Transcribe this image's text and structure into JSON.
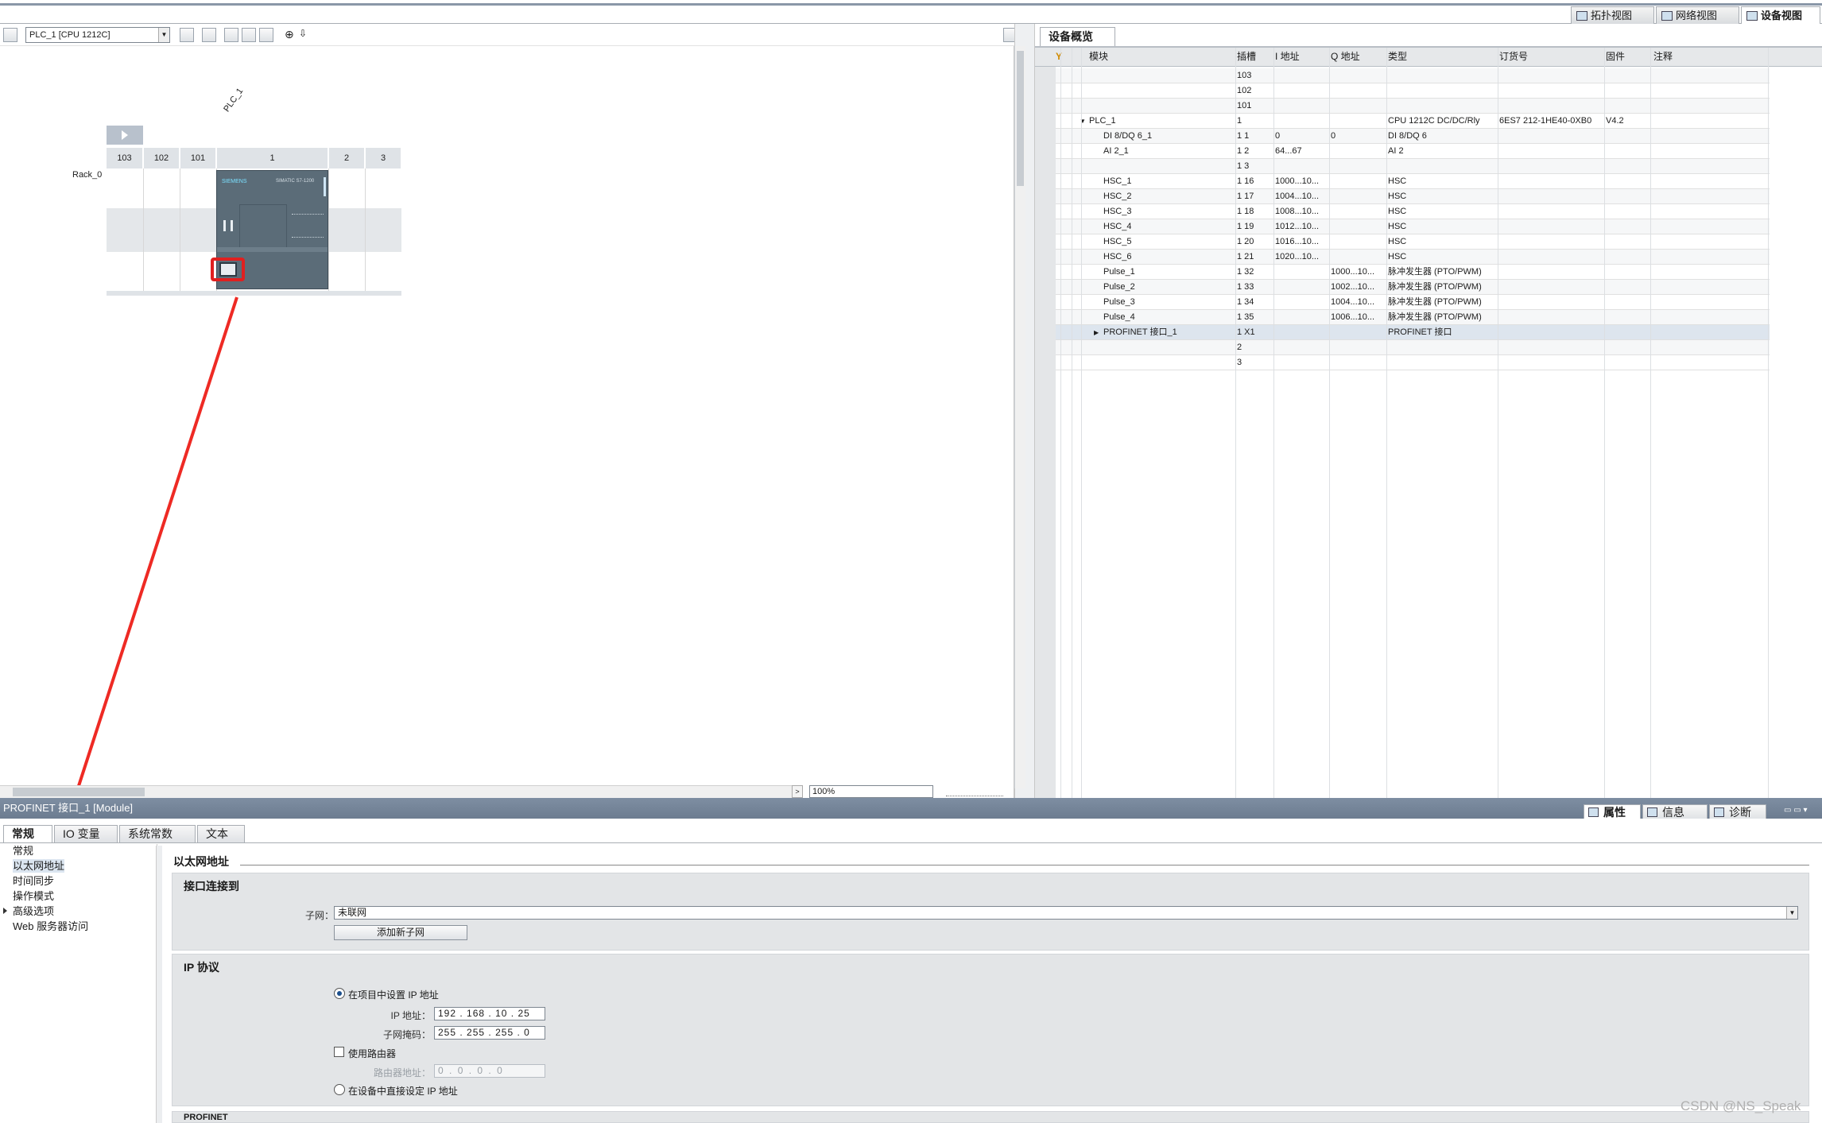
{
  "views": {
    "topology": "拓扑视图",
    "network": "网络视图",
    "device": "设备视图"
  },
  "canvas": {
    "device_select": "PLC_1 [CPU 1212C]",
    "plc_label": "PLC_1",
    "rack_label": "Rack_0",
    "slots": [
      "103",
      "102",
      "101",
      "1",
      "2",
      "3"
    ],
    "zoom": "100%",
    "cpu_brand": "SIEMENS",
    "cpu_model": "SIMATIC S7-1200"
  },
  "overview": {
    "tab": "设备概览",
    "columns": {
      "module": "模块",
      "slot": "插槽",
      "i_addr": "I 地址",
      "q_addr": "Q 地址",
      "type": "类型",
      "order": "订货号",
      "firmware": "固件",
      "comment": "注释"
    },
    "rows": [
      {
        "module": "",
        "slot": "103",
        "i": "",
        "q": "",
        "type": "",
        "order": "",
        "fw": ""
      },
      {
        "module": "",
        "slot": "102",
        "i": "",
        "q": "",
        "type": "",
        "order": "",
        "fw": ""
      },
      {
        "module": "",
        "slot": "101",
        "i": "",
        "q": "",
        "type": "",
        "order": "",
        "fw": ""
      },
      {
        "module": "PLC_1",
        "slot": "1",
        "i": "",
        "q": "",
        "type": "CPU 1212C DC/DC/Rly",
        "order": "6ES7 212-1HE40-0XB0",
        "fw": "V4.2"
      },
      {
        "module": "DI 8/DQ 6_1",
        "slot": "1 1",
        "i": "0",
        "q": "0",
        "type": "DI 8/DQ 6",
        "order": "",
        "fw": ""
      },
      {
        "module": "AI 2_1",
        "slot": "1 2",
        "i": "64...67",
        "q": "",
        "type": "AI 2",
        "order": "",
        "fw": ""
      },
      {
        "module": "",
        "slot": "1 3",
        "i": "",
        "q": "",
        "type": "",
        "order": "",
        "fw": ""
      },
      {
        "module": "HSC_1",
        "slot": "1 16",
        "i": "1000...10...",
        "q": "",
        "type": "HSC",
        "order": "",
        "fw": ""
      },
      {
        "module": "HSC_2",
        "slot": "1 17",
        "i": "1004...10...",
        "q": "",
        "type": "HSC",
        "order": "",
        "fw": ""
      },
      {
        "module": "HSC_3",
        "slot": "1 18",
        "i": "1008...10...",
        "q": "",
        "type": "HSC",
        "order": "",
        "fw": ""
      },
      {
        "module": "HSC_4",
        "slot": "1 19",
        "i": "1012...10...",
        "q": "",
        "type": "HSC",
        "order": "",
        "fw": ""
      },
      {
        "module": "HSC_5",
        "slot": "1 20",
        "i": "1016...10...",
        "q": "",
        "type": "HSC",
        "order": "",
        "fw": ""
      },
      {
        "module": "HSC_6",
        "slot": "1 21",
        "i": "1020...10...",
        "q": "",
        "type": "HSC",
        "order": "",
        "fw": ""
      },
      {
        "module": "Pulse_1",
        "slot": "1 32",
        "i": "",
        "q": "1000...10...",
        "type": "脉冲发生器 (PTO/PWM)",
        "order": "",
        "fw": ""
      },
      {
        "module": "Pulse_2",
        "slot": "1 33",
        "i": "",
        "q": "1002...10...",
        "type": "脉冲发生器 (PTO/PWM)",
        "order": "",
        "fw": ""
      },
      {
        "module": "Pulse_3",
        "slot": "1 34",
        "i": "",
        "q": "1004...10...",
        "type": "脉冲发生器 (PTO/PWM)",
        "order": "",
        "fw": ""
      },
      {
        "module": "Pulse_4",
        "slot": "1 35",
        "i": "",
        "q": "1006...10...",
        "type": "脉冲发生器 (PTO/PWM)",
        "order": "",
        "fw": ""
      },
      {
        "module": "PROFINET 接口_1",
        "slot": "1 X1",
        "i": "",
        "q": "",
        "type": "PROFINET 接口",
        "order": "",
        "fw": ""
      },
      {
        "module": "",
        "slot": "2",
        "i": "",
        "q": "",
        "type": "",
        "order": "",
        "fw": ""
      },
      {
        "module": "",
        "slot": "3",
        "i": "",
        "q": "",
        "type": "",
        "order": "",
        "fw": ""
      }
    ]
  },
  "inspector": {
    "title": "PROFINET 接口_1 [Module]",
    "tabs": [
      "常规",
      "IO 变量",
      "系统常数",
      "文本"
    ],
    "right_tabs": {
      "properties": "属性",
      "info": "信息",
      "diagnostics": "诊断"
    },
    "nav": [
      "常规",
      "以太网地址",
      "时间同步",
      "操作模式",
      "高级选项",
      "Web 服务器访问"
    ],
    "heading": "以太网地址",
    "interface_section": "接口连接到",
    "subnet_label": "子网：",
    "subnet_value": "未联网",
    "add_subnet": "添加新子网",
    "ip_section": "IP 协议",
    "opt_project": "在项目中设置 IP 地址",
    "ip_label": "IP 地址：",
    "ip": [
      "192",
      "168",
      "10",
      "25"
    ],
    "mask_label": "子网掩码：",
    "mask": [
      "255",
      "255",
      "255",
      "0"
    ],
    "use_router": "使用路由器",
    "router_label": "路由器地址：",
    "router": [
      "0",
      "0",
      "0",
      "0"
    ],
    "opt_device": "在设备中直接设定 IP 地址",
    "next_section": "PROFINET"
  },
  "watermark": "CSDN @NS_Speak",
  "colors": {
    "highlight": "#e02020",
    "arrow": "#ee2a24",
    "header_bar": "#7586a0"
  }
}
